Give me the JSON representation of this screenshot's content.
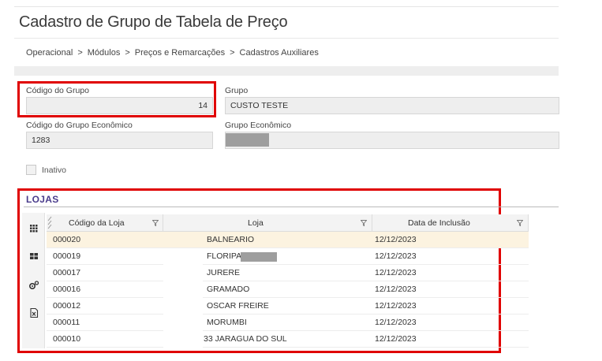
{
  "page": {
    "title": "Cadastro de Grupo de Tabela de Preço",
    "breadcrumb": [
      "Operacional",
      "Módulos",
      "Preços e Remarcações",
      "Cadastros Auxiliares"
    ],
    "breadcrumb_sep": ">"
  },
  "form": {
    "codigo_grupo_label": "Código do Grupo",
    "codigo_grupo_value": "14",
    "grupo_label": "Grupo",
    "grupo_value": "CUSTO TESTE",
    "codigo_grupo_economico_label": "Código do Grupo Econômico",
    "codigo_grupo_economico_value": "1283",
    "grupo_economico_label": "Grupo Econômico",
    "grupo_economico_value": "",
    "inativo_label": "Inativo",
    "inativo_checked": false
  },
  "lojas": {
    "title": "LOJAS",
    "columns": [
      "Código da Loja",
      "Loja",
      "Data de Inclusão"
    ],
    "rows": [
      {
        "codigo": "000020",
        "loja": "BALNEARIO",
        "data": "12/12/2023",
        "selected": true
      },
      {
        "codigo": "000019",
        "loja": "FLORIPA",
        "data": "12/12/2023",
        "masked": true
      },
      {
        "codigo": "000017",
        "loja": "JURERE",
        "data": "12/12/2023"
      },
      {
        "codigo": "000016",
        "loja": "GRAMADO",
        "data": "12/12/2023"
      },
      {
        "codigo": "000012",
        "loja": "OSCAR FREIRE",
        "data": "12/12/2023"
      },
      {
        "codigo": "000011",
        "loja": "MORUMBI",
        "data": "12/12/2023"
      },
      {
        "codigo": "000010",
        "loja": "33 JARAGUA DO SUL",
        "data": "12/12/2023"
      }
    ],
    "sidebar_icons": [
      "grid-view-icon",
      "card-view-icon",
      "settings-icon",
      "excel-export-icon"
    ]
  },
  "colors": {
    "highlight_border": "#e00000",
    "section_title": "#4a3c8c",
    "selected_row": "#fcf3e0"
  }
}
